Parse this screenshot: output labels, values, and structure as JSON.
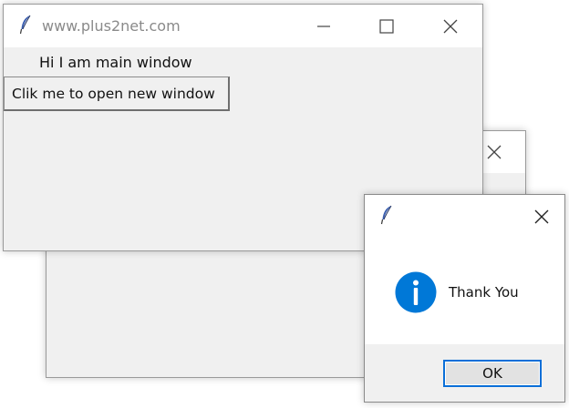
{
  "main_window": {
    "title": "www.plus2net.com",
    "label": "Hi I am main window",
    "open_button_label": "Clik me to open new window",
    "icons": [
      "feather-icon",
      "minimize-icon",
      "maximize-icon",
      "close-icon"
    ]
  },
  "second_window": {
    "icons": [
      "close-icon"
    ]
  },
  "message_box": {
    "message": "Thank You",
    "ok_label": "OK",
    "icons": [
      "feather-icon",
      "close-icon",
      "info-icon"
    ]
  },
  "colors": {
    "accent": "#0078d7",
    "ok_border": "#0a6fd8",
    "window_bg": "#f0f0f0",
    "title_text": "#8a8a8a"
  }
}
